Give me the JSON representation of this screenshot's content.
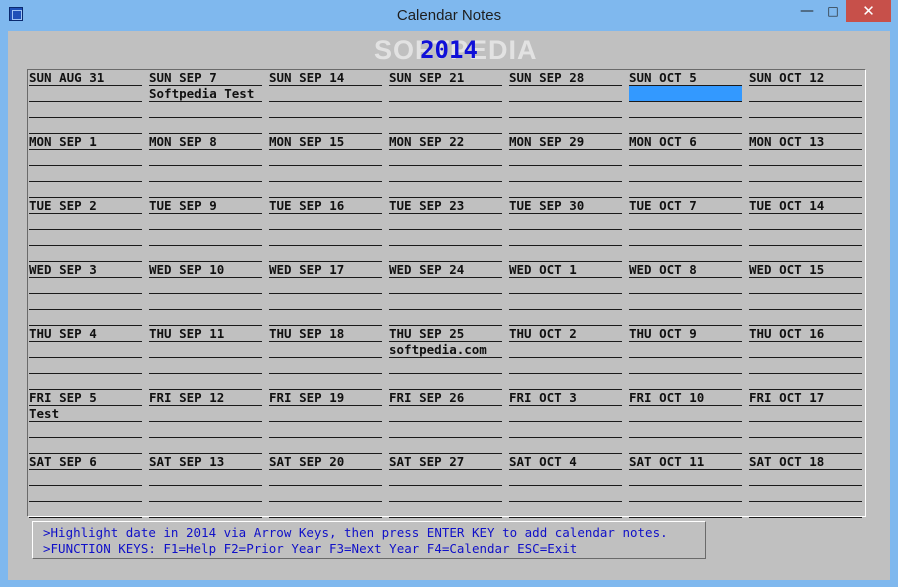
{
  "window": {
    "title": "Calendar Notes",
    "minimize": "—",
    "maximize": "□",
    "close": "✕"
  },
  "year": "2014",
  "watermark": "SOFTPEDIA",
  "weeks": [
    [
      {
        "label": "SUN AUG 31",
        "notes": [
          "",
          ""
        ]
      },
      {
        "label": "MON SEP 1",
        "notes": [
          "",
          ""
        ]
      },
      {
        "label": "TUE SEP 2",
        "notes": [
          "",
          ""
        ]
      },
      {
        "label": "WED SEP 3",
        "notes": [
          "",
          ""
        ]
      },
      {
        "label": "THU SEP 4",
        "notes": [
          "",
          ""
        ]
      },
      {
        "label": "FRI SEP 5",
        "notes": [
          "Test",
          ""
        ]
      },
      {
        "label": "SAT SEP 6",
        "notes": [
          "",
          ""
        ]
      }
    ],
    [
      {
        "label": "SUN SEP 7",
        "notes": [
          "Softpedia Test",
          ""
        ]
      },
      {
        "label": "MON SEP 8",
        "notes": [
          "",
          ""
        ]
      },
      {
        "label": "TUE SEP 9",
        "notes": [
          "",
          ""
        ]
      },
      {
        "label": "WED SEP 10",
        "notes": [
          "",
          ""
        ]
      },
      {
        "label": "THU SEP 11",
        "notes": [
          "",
          ""
        ]
      },
      {
        "label": "FRI SEP 12",
        "notes": [
          "",
          ""
        ]
      },
      {
        "label": "SAT SEP 13",
        "notes": [
          "",
          ""
        ]
      }
    ],
    [
      {
        "label": "SUN SEP 14",
        "notes": [
          "",
          ""
        ]
      },
      {
        "label": "MON SEP 15",
        "notes": [
          "",
          ""
        ]
      },
      {
        "label": "TUE SEP 16",
        "notes": [
          "",
          ""
        ]
      },
      {
        "label": "WED SEP 17",
        "notes": [
          "",
          ""
        ]
      },
      {
        "label": "THU SEP 18",
        "notes": [
          "",
          ""
        ]
      },
      {
        "label": "FRI SEP 19",
        "notes": [
          "",
          ""
        ]
      },
      {
        "label": "SAT SEP 20",
        "notes": [
          "",
          ""
        ]
      }
    ],
    [
      {
        "label": "SUN SEP 21",
        "notes": [
          "",
          ""
        ]
      },
      {
        "label": "MON SEP 22",
        "notes": [
          "",
          ""
        ]
      },
      {
        "label": "TUE SEP 23",
        "notes": [
          "",
          ""
        ]
      },
      {
        "label": "WED SEP 24",
        "notes": [
          "",
          ""
        ]
      },
      {
        "label": "THU SEP 25",
        "notes": [
          "softpedia.com",
          ""
        ]
      },
      {
        "label": "FRI SEP 26",
        "notes": [
          "",
          ""
        ]
      },
      {
        "label": "SAT SEP 27",
        "notes": [
          "",
          ""
        ]
      }
    ],
    [
      {
        "label": "SUN SEP 28",
        "notes": [
          "",
          ""
        ]
      },
      {
        "label": "MON SEP 29",
        "notes": [
          "",
          ""
        ]
      },
      {
        "label": "TUE SEP 30",
        "notes": [
          "",
          ""
        ]
      },
      {
        "label": "WED OCT 1",
        "notes": [
          "",
          ""
        ]
      },
      {
        "label": "THU OCT 2",
        "notes": [
          "",
          ""
        ]
      },
      {
        "label": "FRI OCT 3",
        "notes": [
          "",
          ""
        ]
      },
      {
        "label": "SAT OCT 4",
        "notes": [
          "",
          ""
        ]
      }
    ],
    [
      {
        "label": "SUN OCT 5",
        "notes": [
          "",
          ""
        ],
        "highlighted": true
      },
      {
        "label": "MON OCT 6",
        "notes": [
          "",
          ""
        ]
      },
      {
        "label": "TUE OCT 7",
        "notes": [
          "",
          ""
        ]
      },
      {
        "label": "WED OCT 8",
        "notes": [
          "",
          ""
        ]
      },
      {
        "label": "THU OCT 9",
        "notes": [
          "",
          ""
        ]
      },
      {
        "label": "FRI OCT 10",
        "notes": [
          "",
          ""
        ]
      },
      {
        "label": "SAT OCT 11",
        "notes": [
          "",
          ""
        ]
      }
    ],
    [
      {
        "label": "SUN OCT 12",
        "notes": [
          "",
          ""
        ]
      },
      {
        "label": "MON OCT 13",
        "notes": [
          "",
          ""
        ]
      },
      {
        "label": "TUE OCT 14",
        "notes": [
          "",
          ""
        ]
      },
      {
        "label": "WED OCT 15",
        "notes": [
          "",
          ""
        ]
      },
      {
        "label": "THU OCT 16",
        "notes": [
          "",
          ""
        ]
      },
      {
        "label": "FRI OCT 17",
        "notes": [
          "",
          ""
        ]
      },
      {
        "label": "SAT OCT 18",
        "notes": [
          "",
          ""
        ]
      }
    ]
  ],
  "status": {
    "line1": ">Highlight date in 2014 via Arrow Keys, then press ENTER KEY to add calendar notes.",
    "line2": ">FUNCTION KEYS: F1=Help  F2=Prior Year  F3=Next Year  F4=Calendar  ESC=Exit"
  },
  "colors": {
    "year": "#1010d8",
    "status_text": "#1010c8",
    "highlight": "#3399ff",
    "client_bg": "#c0c0c0",
    "titlebar": "#7fb8ee",
    "close_button": "#c7504a"
  }
}
